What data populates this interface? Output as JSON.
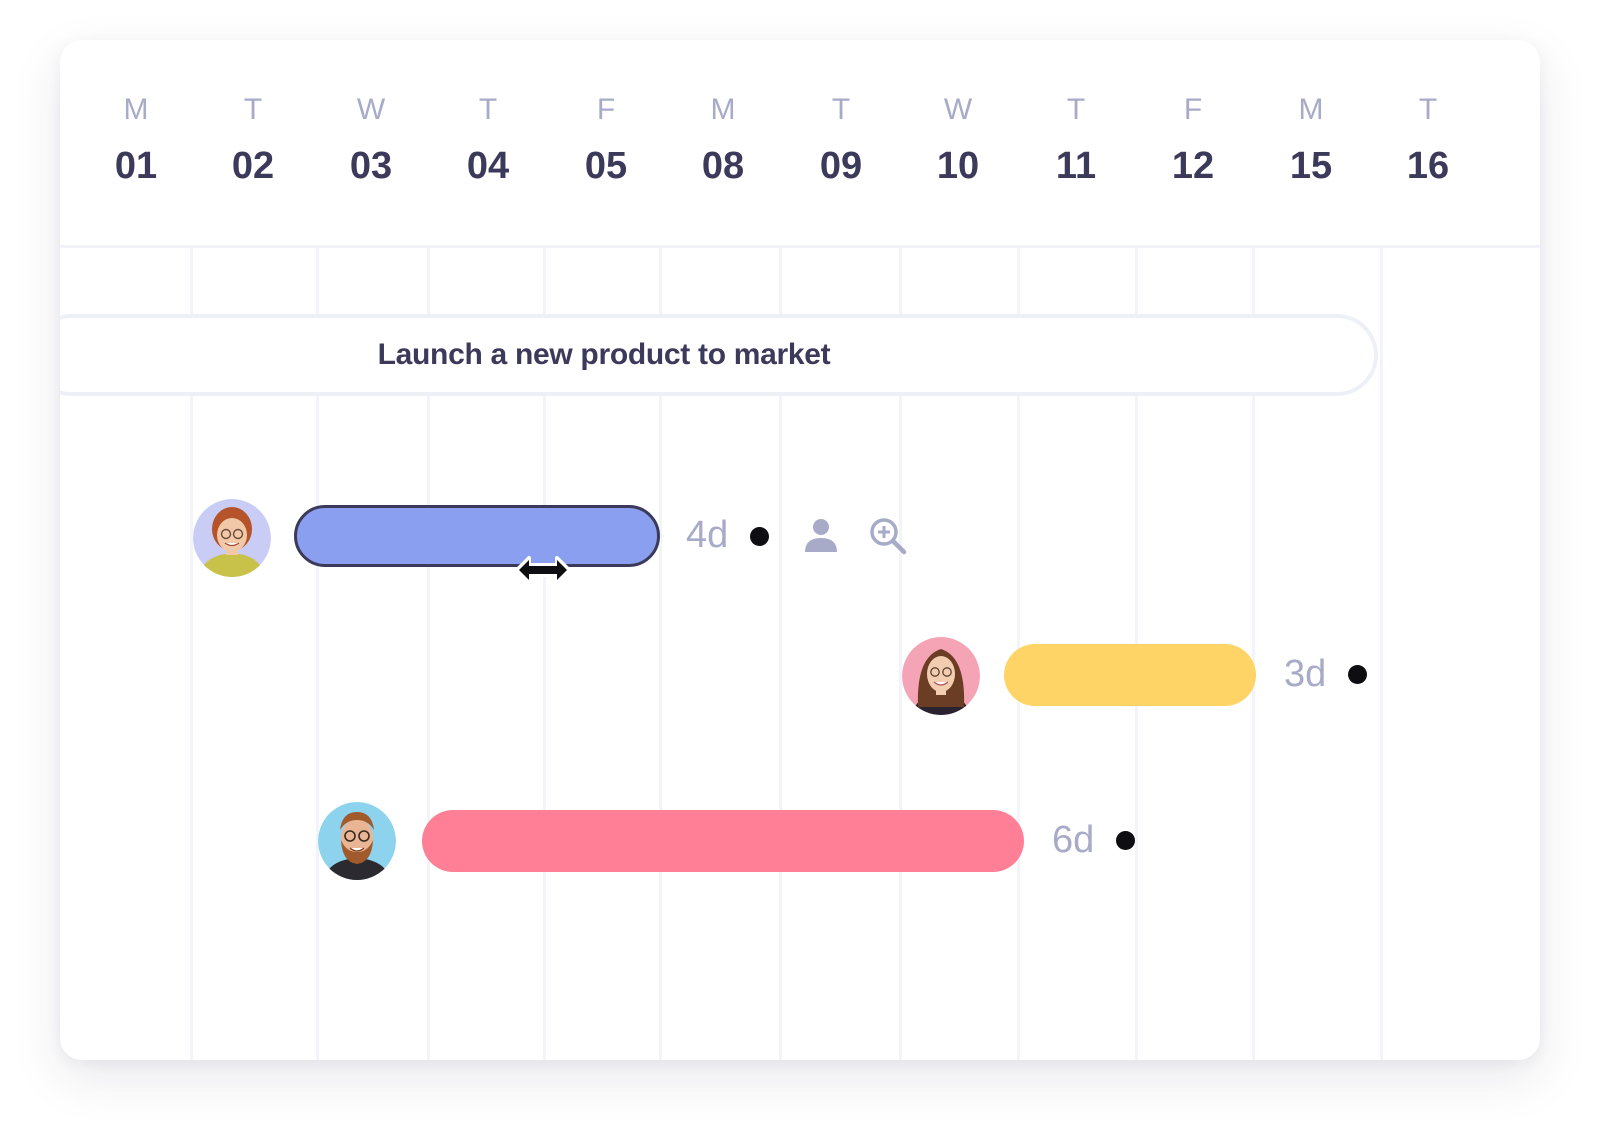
{
  "timeline": {
    "days": [
      {
        "weekday": "M",
        "date": "01"
      },
      {
        "weekday": "T",
        "date": "02"
      },
      {
        "weekday": "W",
        "date": "03"
      },
      {
        "weekday": "T",
        "date": "04"
      },
      {
        "weekday": "F",
        "date": "05"
      },
      {
        "weekday": "M",
        "date": "08"
      },
      {
        "weekday": "T",
        "date": "09"
      },
      {
        "weekday": "W",
        "date": "10"
      },
      {
        "weekday": "T",
        "date": "11"
      },
      {
        "weekday": "F",
        "date": "12"
      },
      {
        "weekday": "M",
        "date": "15"
      },
      {
        "weekday": "T",
        "date": "16"
      }
    ]
  },
  "project": {
    "title": "Launch a new product to market"
  },
  "tasks": [
    {
      "assignee_avatar": "avatar-woman-redhair",
      "color": "#8b9ff0",
      "duration": "4d",
      "selected": true
    },
    {
      "assignee_avatar": "avatar-woman-brownhair",
      "color": "#ffd466",
      "duration": "3d",
      "selected": false
    },
    {
      "assignee_avatar": "avatar-man-beard",
      "color": "#ff7f96",
      "duration": "6d",
      "selected": false
    }
  ],
  "icons": {
    "assign": "person-icon",
    "zoom": "zoom-in-icon",
    "cursor": "resize-horizontal-cursor-icon"
  },
  "colors": {
    "text_primary": "#3b3a5a",
    "text_muted": "#a8abc8",
    "grid": "#f3f4f9"
  }
}
